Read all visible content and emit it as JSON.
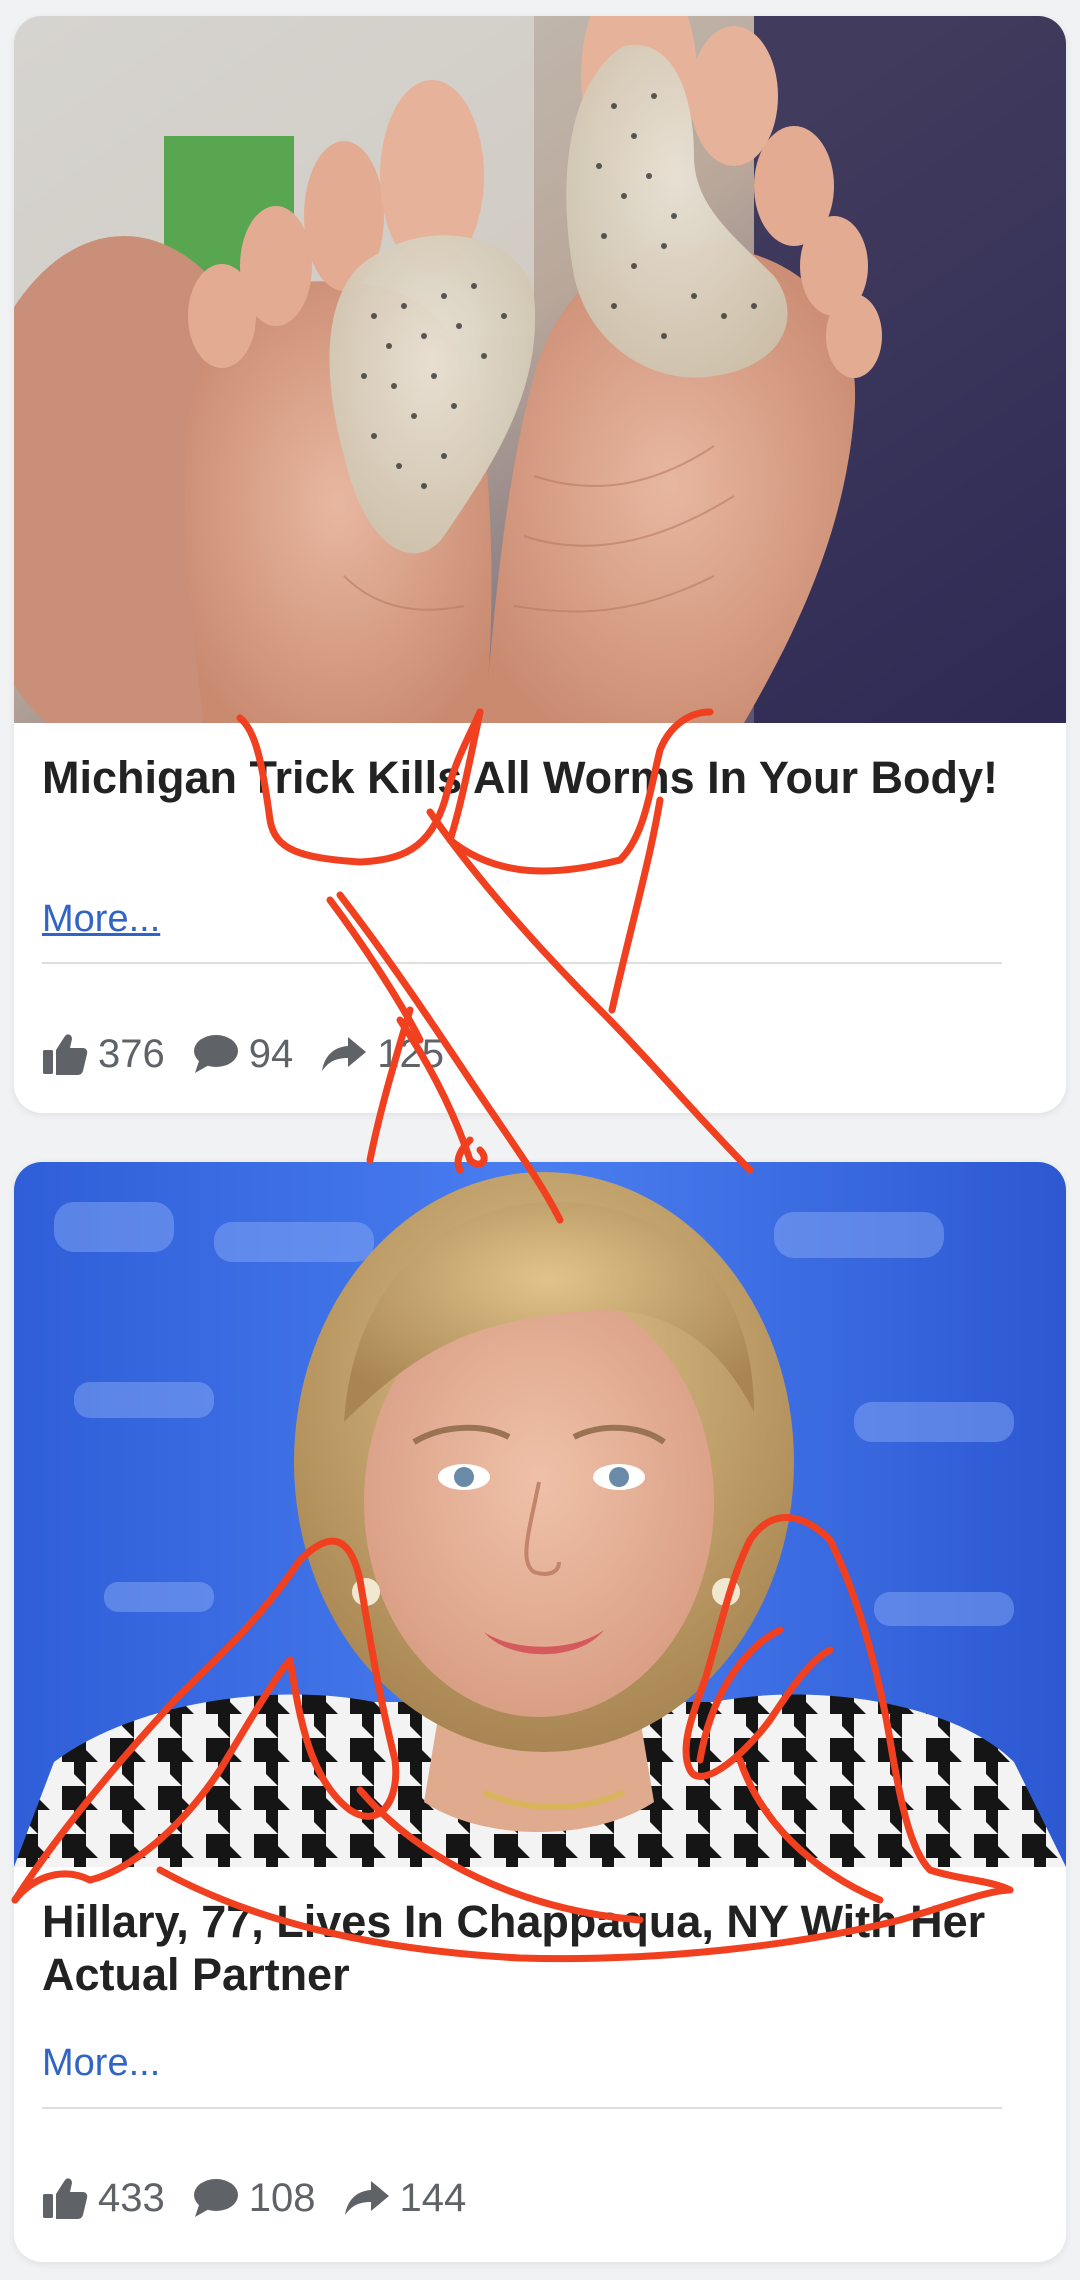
{
  "colors": {
    "background": "#f1f2f4",
    "card": "#ffffff",
    "title_text": "#222222",
    "link": "#3165c5",
    "stat_text": "#5f6368",
    "annotation_ink": "#f0401f"
  },
  "cards": [
    {
      "image_icon": "feet-with-gel-toe-pads-photo",
      "title": "Michigan Trick Kills All Worms In Your Body!",
      "more_label": "More...",
      "stats": {
        "likes": "376",
        "comments": "94",
        "shares": "125"
      }
    },
    {
      "image_icon": "woman-portrait-photo",
      "title": "Hillary, 77, Lives In Chappaqua, NY With Her Actual Partner",
      "more_label": "More...",
      "stats": {
        "likes": "433",
        "comments": "108",
        "shares": "144"
      }
    }
  ],
  "icons": {
    "like": "thumbs-up-icon",
    "comment": "speech-bubble-icon",
    "share": "share-arrow-icon"
  }
}
